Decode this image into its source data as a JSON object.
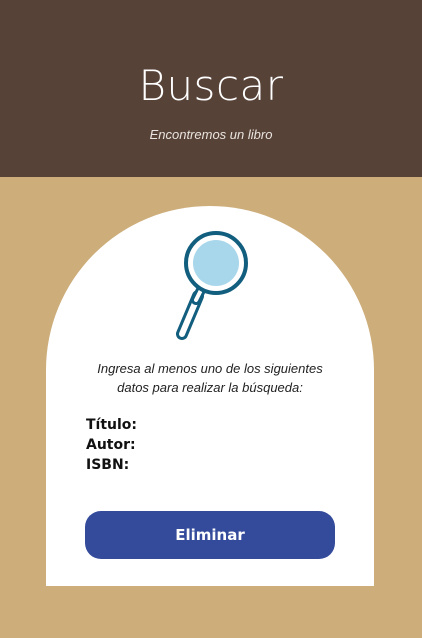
{
  "header": {
    "title": "Buscar",
    "subtitle": "Encontremos un libro"
  },
  "card": {
    "icon": "magnifying-glass-icon",
    "instructions_line1": "Ingresa al menos uno de los siguientes",
    "instructions_line2": "datos para realizar la búsqueda:",
    "fields": [
      {
        "label": "Título:"
      },
      {
        "label": "Autor:"
      },
      {
        "label": "ISBN:"
      }
    ],
    "button_label": "Eliminar"
  },
  "colors": {
    "header_bg": "#574238",
    "page_bg": "#cdad7a",
    "button_bg": "#344b9c",
    "icon_stroke": "#125e7e",
    "icon_lens": "#a8d6ea"
  }
}
